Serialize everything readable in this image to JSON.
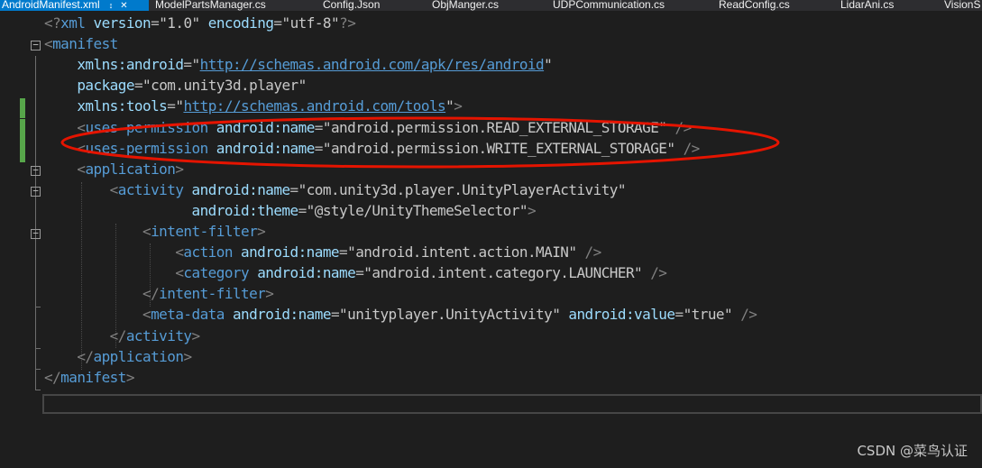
{
  "tabs": [
    {
      "label": "AndroidManifest.xml",
      "active": true,
      "pin_icon": "pin-icon",
      "close_icon": "close-icon"
    },
    {
      "label": "ModelPartsManager.cs"
    },
    {
      "label": "Config.Json"
    },
    {
      "label": "ObjManger.cs"
    },
    {
      "label": "UDPCommunication.cs"
    },
    {
      "label": "ReadConfig.cs"
    },
    {
      "label": "LidarAni.cs"
    },
    {
      "label": "VisionS"
    }
  ],
  "editor": {
    "lines": [
      {
        "tokens": [
          [
            "bracket",
            "<?"
          ],
          [
            "tag",
            "xml"
          ],
          [
            "text",
            " "
          ],
          [
            "attr",
            "version"
          ],
          [
            "eq",
            "="
          ],
          [
            "quote",
            "\""
          ],
          [
            "val",
            "1.0"
          ],
          [
            "quote",
            "\""
          ],
          [
            "text",
            " "
          ],
          [
            "attr",
            "encoding"
          ],
          [
            "eq",
            "="
          ],
          [
            "quote",
            "\""
          ],
          [
            "val",
            "utf-8"
          ],
          [
            "quote",
            "\""
          ],
          [
            "bracket",
            "?>"
          ]
        ]
      },
      {
        "tokens": [
          [
            "bracket",
            "<"
          ],
          [
            "tag",
            "manifest"
          ]
        ]
      },
      {
        "tokens": [
          [
            "text",
            "    "
          ],
          [
            "attr",
            "xmlns:android"
          ],
          [
            "eq",
            "="
          ],
          [
            "quote",
            "\""
          ],
          [
            "link",
            "http://schemas.android.com/apk/res/android"
          ],
          [
            "quote",
            "\""
          ]
        ]
      },
      {
        "tokens": [
          [
            "text",
            "    "
          ],
          [
            "attr",
            "package"
          ],
          [
            "eq",
            "="
          ],
          [
            "quote",
            "\""
          ],
          [
            "val",
            "com.unity3d.player"
          ],
          [
            "quote",
            "\""
          ]
        ]
      },
      {
        "tokens": [
          [
            "text",
            "    "
          ],
          [
            "attr",
            "xmlns:tools"
          ],
          [
            "eq",
            "="
          ],
          [
            "quote",
            "\""
          ],
          [
            "link",
            "http://schemas.android.com/tools"
          ],
          [
            "quote",
            "\""
          ],
          [
            "bracket",
            ">"
          ]
        ]
      },
      {
        "tokens": [
          [
            "text",
            "    "
          ],
          [
            "bracket",
            "<"
          ],
          [
            "tag",
            "uses-permission"
          ],
          [
            "text",
            " "
          ],
          [
            "attr",
            "android:name"
          ],
          [
            "eq",
            "="
          ],
          [
            "quote",
            "\""
          ],
          [
            "val",
            "android.permission.READ_EXTERNAL_STORAGE"
          ],
          [
            "quote",
            "\""
          ],
          [
            "text",
            " "
          ],
          [
            "bracket",
            "/>"
          ]
        ]
      },
      {
        "tokens": [
          [
            "text",
            "    "
          ],
          [
            "bracket",
            "<"
          ],
          [
            "tag",
            "uses-permission"
          ],
          [
            "text",
            " "
          ],
          [
            "attr",
            "android:name"
          ],
          [
            "eq",
            "="
          ],
          [
            "quote",
            "\""
          ],
          [
            "val",
            "android.permission.WRITE_EXTERNAL_STORAGE"
          ],
          [
            "quote",
            "\""
          ],
          [
            "text",
            " "
          ],
          [
            "bracket",
            "/>"
          ]
        ]
      },
      {
        "tokens": [
          [
            "text",
            "    "
          ],
          [
            "bracket",
            "<"
          ],
          [
            "tag",
            "application"
          ],
          [
            "bracket",
            ">"
          ]
        ]
      },
      {
        "tokens": [
          [
            "text",
            "        "
          ],
          [
            "bracket",
            "<"
          ],
          [
            "tag",
            "activity"
          ],
          [
            "text",
            " "
          ],
          [
            "attr",
            "android:name"
          ],
          [
            "eq",
            "="
          ],
          [
            "quote",
            "\""
          ],
          [
            "val",
            "com.unity3d.player.UnityPlayerActivity"
          ],
          [
            "quote",
            "\""
          ]
        ]
      },
      {
        "tokens": [
          [
            "text",
            "                  "
          ],
          [
            "attr",
            "android:theme"
          ],
          [
            "eq",
            "="
          ],
          [
            "quote",
            "\""
          ],
          [
            "val",
            "@style/UnityThemeSelector"
          ],
          [
            "quote",
            "\""
          ],
          [
            "bracket",
            ">"
          ]
        ]
      },
      {
        "tokens": [
          [
            "text",
            "            "
          ],
          [
            "bracket",
            "<"
          ],
          [
            "tag",
            "intent-filter"
          ],
          [
            "bracket",
            ">"
          ]
        ]
      },
      {
        "tokens": [
          [
            "text",
            "                "
          ],
          [
            "bracket",
            "<"
          ],
          [
            "tag",
            "action"
          ],
          [
            "text",
            " "
          ],
          [
            "attr",
            "android:name"
          ],
          [
            "eq",
            "="
          ],
          [
            "quote",
            "\""
          ],
          [
            "val",
            "android.intent.action.MAIN"
          ],
          [
            "quote",
            "\""
          ],
          [
            "text",
            " "
          ],
          [
            "bracket",
            "/>"
          ]
        ]
      },
      {
        "tokens": [
          [
            "text",
            "                "
          ],
          [
            "bracket",
            "<"
          ],
          [
            "tag",
            "category"
          ],
          [
            "text",
            " "
          ],
          [
            "attr",
            "android:name"
          ],
          [
            "eq",
            "="
          ],
          [
            "quote",
            "\""
          ],
          [
            "val",
            "android.intent.category.LAUNCHER"
          ],
          [
            "quote",
            "\""
          ],
          [
            "text",
            " "
          ],
          [
            "bracket",
            "/>"
          ]
        ]
      },
      {
        "tokens": [
          [
            "text",
            "            "
          ],
          [
            "bracket",
            "</"
          ],
          [
            "tag",
            "intent-filter"
          ],
          [
            "bracket",
            ">"
          ]
        ]
      },
      {
        "tokens": [
          [
            "text",
            "            "
          ],
          [
            "bracket",
            "<"
          ],
          [
            "tag",
            "meta-data"
          ],
          [
            "text",
            " "
          ],
          [
            "attr",
            "android:name"
          ],
          [
            "eq",
            "="
          ],
          [
            "quote",
            "\""
          ],
          [
            "val",
            "unityplayer.UnityActivity"
          ],
          [
            "quote",
            "\""
          ],
          [
            "text",
            " "
          ],
          [
            "attr",
            "android:value"
          ],
          [
            "eq",
            "="
          ],
          [
            "quote",
            "\""
          ],
          [
            "val",
            "true"
          ],
          [
            "quote",
            "\""
          ],
          [
            "text",
            " "
          ],
          [
            "bracket",
            "/>"
          ]
        ]
      },
      {
        "tokens": [
          [
            "text",
            "        "
          ],
          [
            "bracket",
            "</"
          ],
          [
            "tag",
            "activity"
          ],
          [
            "bracket",
            ">"
          ]
        ]
      },
      {
        "tokens": [
          [
            "text",
            "    "
          ],
          [
            "bracket",
            "</"
          ],
          [
            "tag",
            "application"
          ],
          [
            "bracket",
            ">"
          ]
        ]
      },
      {
        "tokens": [
          [
            "bracket",
            "</"
          ],
          [
            "tag",
            "manifest"
          ],
          [
            "bracket",
            ">"
          ]
        ]
      },
      {
        "tokens": []
      }
    ],
    "fold_icons": [
      "minus-box-icon"
    ],
    "annotation_color": "#e51400"
  },
  "watermark": "CSDN @菜鸟认证",
  "colors": {
    "background": "#1e1e1e",
    "tab_active": "#007acc",
    "tag": "#569cd6",
    "attr": "#9cdcfe",
    "value": "#c8c8c8",
    "bracket": "#808080",
    "change_marker": "#57a64a"
  }
}
